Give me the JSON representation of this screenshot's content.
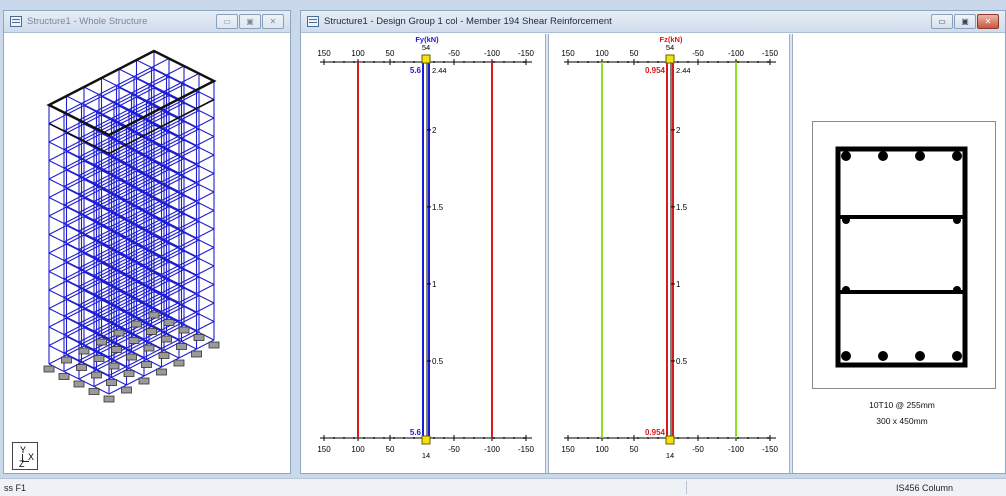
{
  "left_window": {
    "title": "Structure1 - Whole Structure",
    "buttons": [
      "▭",
      "▣",
      "✕"
    ],
    "axis": {
      "y": "Y",
      "x": "X",
      "z": "Z"
    }
  },
  "right_window": {
    "title": "Structure1 - Design Group 1 col - Member 194 Shear Reinforcement",
    "buttons": [
      "▭",
      "▣",
      "✕"
    ]
  },
  "panel_fy": {
    "header": "Fy(kN)",
    "top_marker": "54",
    "bottom_marker": "14",
    "top_value": "5.6",
    "bottom_value": "5.6",
    "height_top": "2.44",
    "ticks": [
      "150",
      "100",
      "50",
      "-50",
      "-100",
      "-150"
    ],
    "scale": [
      "2",
      "1.5",
      "1",
      "0.5"
    ],
    "line_color": "#1a1ad8",
    "value_color": "#1a1ad8",
    "limit_color": "#d81a1a"
  },
  "panel_fz": {
    "header": "Fz(kN)",
    "top_marker": "54",
    "bottom_marker": "14",
    "top_value": "0.954",
    "bottom_value": "0.954",
    "height_top": "2.44",
    "ticks": [
      "150",
      "100",
      "50",
      "-50",
      "-100",
      "-150"
    ],
    "scale": [
      "2",
      "1.5",
      "1",
      "0.5"
    ],
    "line_color": "#d81a1a",
    "value_color": "#d81a1a",
    "limit_color": "#8fe020"
  },
  "section": {
    "rebar": "10T10 @ 255mm",
    "size": "300 x 450mm"
  },
  "status_bar": {
    "left": "ss F1",
    "right": "IS456 Column"
  }
}
